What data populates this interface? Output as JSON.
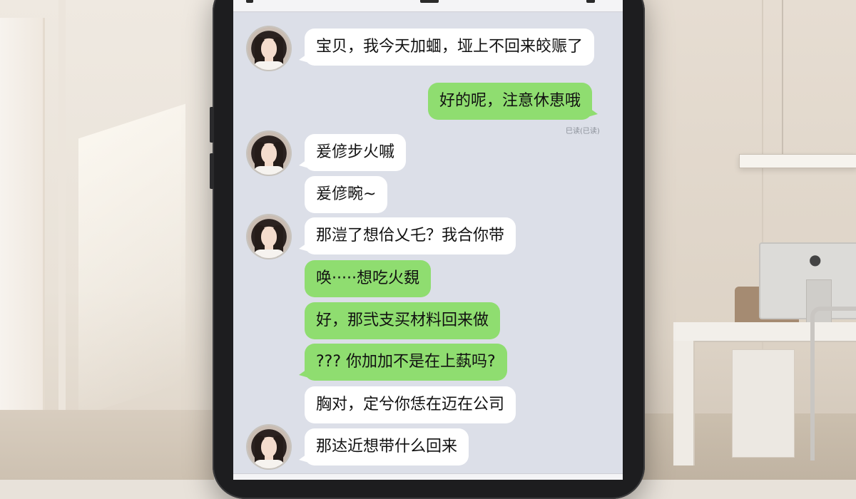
{
  "chat": {
    "messages": [
      {
        "sender": "contact",
        "text": "宝贝，我今天加蜖，垭上不回来皎赈了"
      },
      {
        "sender": "me",
        "text": "好的呢，注意休恵哦",
        "receipt": "巳读(已读)"
      },
      {
        "sender": "contact",
        "text": "爰偐步火嘁"
      },
      {
        "sender": "contact",
        "text": "爰偐畹~"
      },
      {
        "sender": "contact",
        "text": "那溰了想佮乂乇？我合你带"
      },
      {
        "sender": "me",
        "text": "唤·····想吃火覣"
      },
      {
        "sender": "me",
        "text": "好，那弐支买材料回来做"
      },
      {
        "sender": "me",
        "text": "??? 你加加不是在上蓺吗?"
      },
      {
        "sender": "contact",
        "text": "胸对，定兮你恁在迈在公司"
      },
      {
        "sender": "contact",
        "text": "那迏近想带什么回来"
      }
    ]
  },
  "colors": {
    "incoming_bubble": "#ffffff",
    "outgoing_bubble": "#8fdd70",
    "chat_background": "#dcdfe8"
  }
}
